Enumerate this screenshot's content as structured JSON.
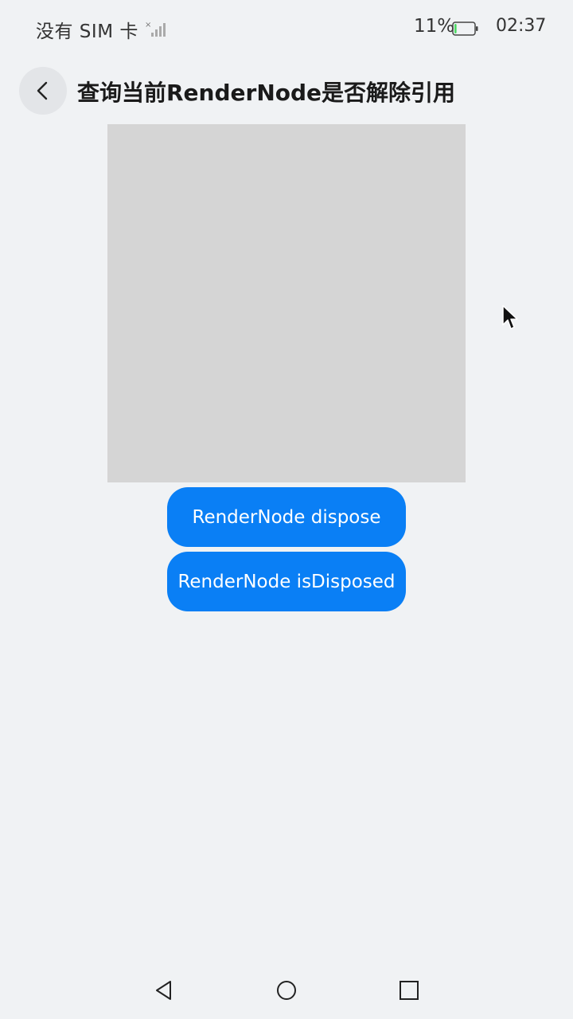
{
  "status_bar": {
    "sim_text": "没有 SIM 卡",
    "signal_icon": "signal-icon",
    "battery_percent": "11%",
    "battery_level": 0.11,
    "battery_color": "#4cd964",
    "time": "02:37"
  },
  "header": {
    "back_icon": "chevron-left-icon",
    "title": "查询当前RenderNode是否解除引用"
  },
  "render_area": {
    "color": "#d5d5d5"
  },
  "buttons": {
    "dispose_label": "RenderNode dispose",
    "is_disposed_label": "RenderNode isDisposed",
    "color": "#0a7ff5"
  },
  "nav_bar": {
    "back_icon": "triangle-back-icon",
    "home_icon": "circle-home-icon",
    "recent_icon": "square-recent-icon"
  }
}
